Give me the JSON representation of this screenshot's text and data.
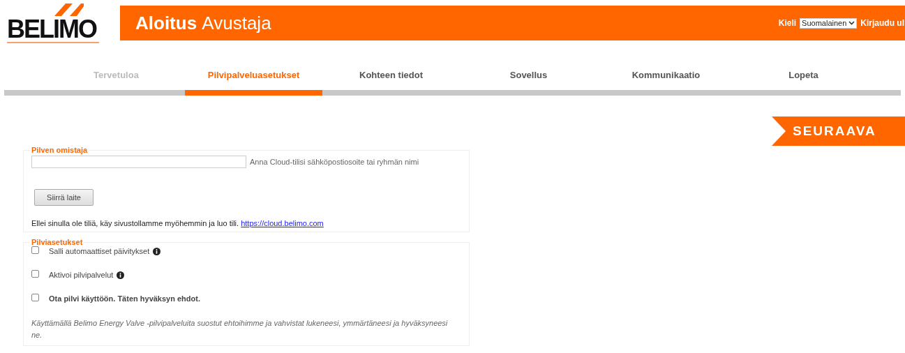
{
  "header": {
    "logo": "BELIMO",
    "title_bold": "Aloitus",
    "title": "Avustaja",
    "language_label": "Kieli",
    "language_value": "Suomalainen",
    "logout": "Kirjaudu ul"
  },
  "tabs": [
    {
      "label": "Tervetuloa",
      "selected": false,
      "disabled": true
    },
    {
      "label": "Pilvipalveluasetukset",
      "selected": true,
      "disabled": false
    },
    {
      "label": "Kohteen tiedot",
      "selected": false,
      "disabled": false
    },
    {
      "label": "Sovellus",
      "selected": false,
      "disabled": false
    },
    {
      "label": "Kommunikaatio",
      "selected": false,
      "disabled": false
    },
    {
      "label": "Lopeta",
      "selected": false,
      "disabled": false
    }
  ],
  "next_button": "SEURAAVA",
  "cloud_owner": {
    "legend": "Pilven omistaja",
    "hint": "Anna Cloud-tilisi sähköpostiosoite tai ryhmän nimi",
    "button": "Siirrä laite",
    "note": "Ellei sinulla ole tiliä, käy sivustollamme myöhemmin ja luo tili.",
    "link": "https://cloud.belimo.com"
  },
  "cloud_settings": {
    "legend": "Pilviasetukset",
    "options": [
      {
        "label": "Salli automaattiset päivitykset",
        "checked": false,
        "info": true,
        "bold": false
      },
      {
        "label": "Aktivoi pilvipalvelut",
        "checked": false,
        "info": true,
        "bold": false
      },
      {
        "label": "Ota pilvi käyttöön. Täten hyväksyn ehdot.",
        "checked": false,
        "info": false,
        "bold": true
      }
    ],
    "terms": "Käyttämällä Belimo Energy Valve -pilvipalveluita suostut ehtoihimme ja vahvistat lukeneesi, ymmärtäneesi ja hyväksyneesi ne."
  }
}
